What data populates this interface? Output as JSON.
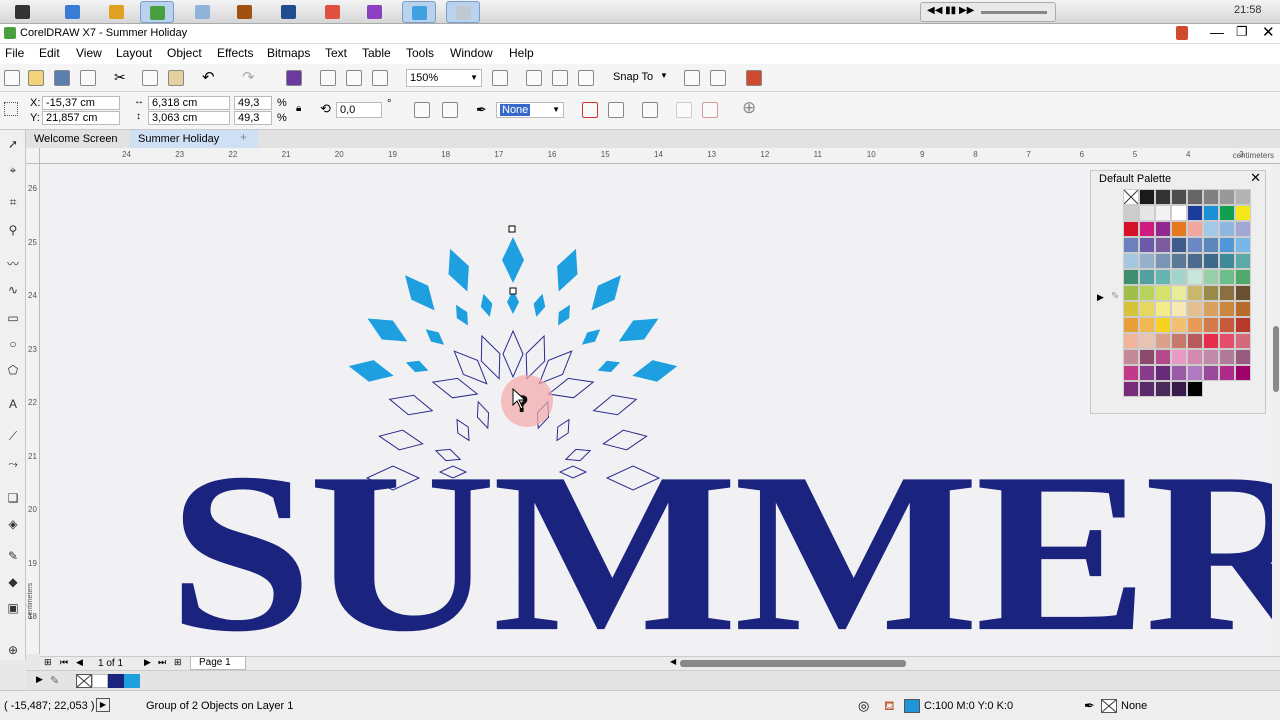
{
  "taskbar": {
    "apps": [
      {
        "name": "apple-icon",
        "color": "#333333",
        "active": false
      },
      {
        "name": "safari-icon",
        "color": "#3a7bd5",
        "active": false
      },
      {
        "name": "chrome-icon",
        "color": "#e0a020",
        "active": false
      },
      {
        "name": "coreldraw-icon",
        "color": "#4aa03f",
        "active": true
      },
      {
        "name": "finder-icon",
        "color": "#8fb3d9",
        "active": false
      },
      {
        "name": "illustrator-icon",
        "color": "#a05010",
        "active": false
      },
      {
        "name": "photoshop-icon",
        "color": "#1e4d90",
        "active": false
      },
      {
        "name": "app-red-icon",
        "color": "#e05040",
        "active": false
      },
      {
        "name": "app-purple-icon",
        "color": "#8a40c0",
        "active": false
      },
      {
        "name": "wifi-icon",
        "color": "#40a0e0",
        "active": true
      },
      {
        "name": "app-window-icon",
        "color": "#c0c8d0",
        "active": true
      }
    ],
    "media_controls": "◀◀ ▮▮ ▶▶",
    "time": "21:58"
  },
  "title": {
    "text": "CorelDRAW X7 - Summer Holiday"
  },
  "menu": [
    "File",
    "Edit",
    "View",
    "Layout",
    "Object",
    "Effects",
    "Bitmaps",
    "Text",
    "Table",
    "Tools",
    "Window",
    "Help"
  ],
  "toolbar": {
    "zoom": "150%",
    "snap_label": "Snap To"
  },
  "propbar": {
    "x_label": "X:",
    "x_value": "-15,37 cm",
    "y_label": "Y:",
    "y_value": "21,857 cm",
    "width_value": "6,318 cm",
    "height_value": "3,063 cm",
    "scale_w": "49,3",
    "scale_h": "49,3",
    "percent": "%",
    "rotation": "0,0",
    "degree": "°",
    "outline": "None"
  },
  "tabs": [
    {
      "label": "Welcome Screen",
      "active": false
    },
    {
      "label": "Summer Holiday",
      "active": true
    }
  ],
  "ruler": {
    "h_ticks": [
      "24",
      "23",
      "22",
      "21",
      "20",
      "19",
      "18",
      "17",
      "16",
      "15",
      "14",
      "13",
      "12",
      "11",
      "10",
      "9",
      "8",
      "7",
      "6",
      "5",
      "4",
      "3"
    ],
    "h_unit": "centimeters",
    "v_ticks": [
      "26",
      "25",
      "24",
      "23",
      "22",
      "21",
      "20",
      "19",
      "18"
    ],
    "v_unit": "centimeters"
  },
  "artwork": {
    "text": "SUMMER",
    "text_color": "#1a237e",
    "shape_color": "#1ea0e0",
    "outline_color": "#2b2b8f"
  },
  "palette": {
    "title": "Default Palette",
    "colors": [
      "none",
      "#1a1a1a",
      "#333333",
      "#4d4d4d",
      "#666666",
      "#808080",
      "#999999",
      "#b3b3b3",
      "#cccccc",
      "#e6e6e6",
      "#f2f2f2",
      "#ffffff",
      "#1b3c9c",
      "#1c8fd9",
      "#11a050",
      "#f5e81a",
      "#d4132b",
      "#d11b80",
      "#92278f",
      "#e6781e",
      "#f1a7a1",
      "#a4c8e8",
      "#8eb7e0",
      "#a2a7d6",
      "#6c7fbf",
      "#6a5aa8",
      "#7c5ba1",
      "#3e5d8e",
      "#6a88c4",
      "#5a88bb",
      "#4f97d6",
      "#78b7e6",
      "#a7c7e0",
      "#96b1cc",
      "#7a95b3",
      "#5a7996",
      "#4b6c8c",
      "#3d6a8a",
      "#3f8a9a",
      "#5da8a8",
      "#3f8f6e",
      "#52a0a0",
      "#65b5b0",
      "#a3d4cc",
      "#c8e6d9",
      "#97cfa9",
      "#6cbf8a",
      "#4ea96b",
      "#9fbf4a",
      "#b8d25c",
      "#d3e26a",
      "#e8ec9a",
      "#c8b86a",
      "#9a8a4a",
      "#8a7040",
      "#6a5030",
      "#d6c33a",
      "#e6d760",
      "#f4ec8a",
      "#f7e9b4",
      "#e5bf8f",
      "#d9a05e",
      "#c9863c",
      "#b86b2a",
      "#e8a03a",
      "#f0b84f",
      "#f7d21f",
      "#f3c070",
      "#e89a56",
      "#d47a4a",
      "#c65a3a",
      "#b83a2a",
      "#f2b49a",
      "#e8c3b0",
      "#dba08a",
      "#c77a6a",
      "#b85a5a",
      "#e62e4c",
      "#e64c6c",
      "#d56a7a",
      "#c48a9a",
      "#8e4a6a",
      "#b34a8a",
      "#e89ac4",
      "#d48ab0",
      "#c28aa8",
      "#b07a98",
      "#9a5a80",
      "#c23a8a",
      "#8a3a8a",
      "#6a2a7a",
      "#9a5aa8",
      "#b07ac0",
      "#9a4a9a",
      "#b02a8a",
      "#a0006a",
      "#7a2a7a",
      "#5a2a6a",
      "#4a2a5a",
      "#3a1a4a",
      "#000000"
    ]
  },
  "pagenav": {
    "count": "1 of 1",
    "page_tab": "Page 1"
  },
  "status": {
    "coords": "( -15,487; 22,053 )",
    "selection": "Group of 2 Objects on Layer 1",
    "fill_color": "#1f94d7",
    "fill_text": "C:100 M:0 Y:0 K:0",
    "outline_text": "None"
  }
}
